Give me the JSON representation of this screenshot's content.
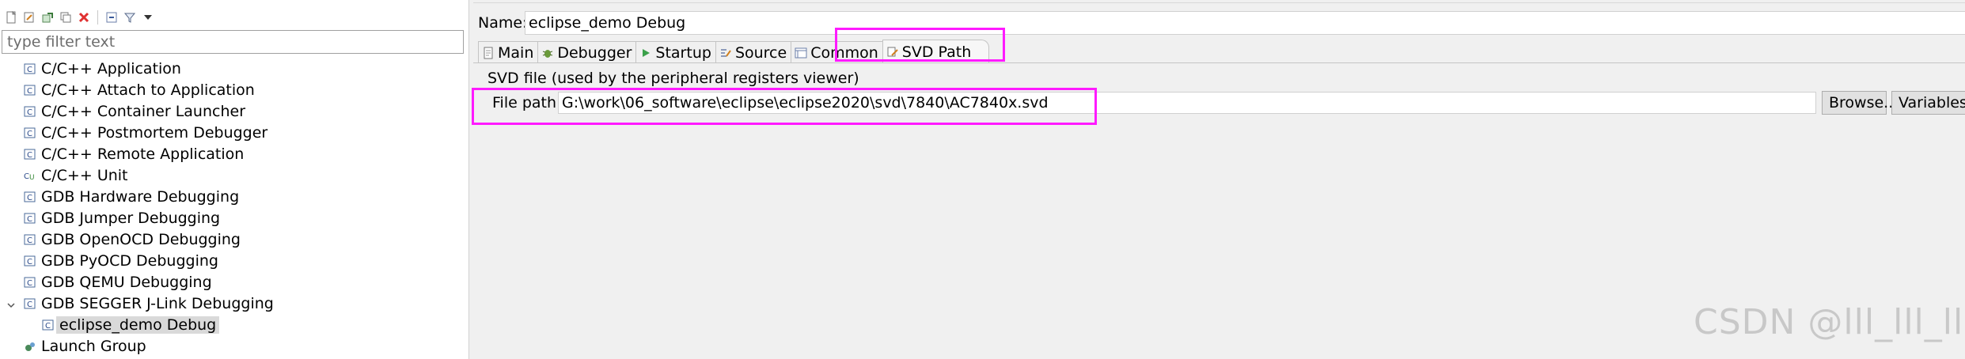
{
  "left_panel": {
    "filter_placeholder": "type filter text",
    "tree": [
      {
        "label": "C/C++ Application",
        "icon": "c-config-icon",
        "level": 1
      },
      {
        "label": "C/C++ Attach to Application",
        "icon": "c-config-icon",
        "level": 1
      },
      {
        "label": "C/C++ Container Launcher",
        "icon": "c-config-icon",
        "level": 1
      },
      {
        "label": "C/C++ Postmortem Debugger",
        "icon": "c-config-icon",
        "level": 1
      },
      {
        "label": "C/C++ Remote Application",
        "icon": "c-config-icon",
        "level": 1
      },
      {
        "label": "C/C++ Unit",
        "icon": "c-unit-icon",
        "level": 1
      },
      {
        "label": "GDB Hardware Debugging",
        "icon": "c-config-icon",
        "level": 1
      },
      {
        "label": "GDB Jumper Debugging",
        "icon": "c-config-icon",
        "level": 1
      },
      {
        "label": "GDB OpenOCD Debugging",
        "icon": "c-config-icon",
        "level": 1
      },
      {
        "label": "GDB PyOCD Debugging",
        "icon": "c-config-icon",
        "level": 1
      },
      {
        "label": "GDB QEMU Debugging",
        "icon": "c-config-icon",
        "level": 1
      },
      {
        "label": "GDB SEGGER J-Link Debugging",
        "icon": "c-config-icon",
        "level": 1,
        "expanded": true
      },
      {
        "label": "eclipse_demo Debug",
        "icon": "c-config-icon",
        "level": 2,
        "selected": true
      },
      {
        "label": "Launch Group",
        "icon": "launch-group-icon",
        "level": 1
      }
    ]
  },
  "right_panel": {
    "name_label": "Name:",
    "name_value": "eclipse_demo Debug",
    "tabs": [
      {
        "label": "Main",
        "icon": "main-tab-icon"
      },
      {
        "label": "Debugger",
        "icon": "debugger-tab-icon"
      },
      {
        "label": "Startup",
        "icon": "startup-tab-icon"
      },
      {
        "label": "Source",
        "icon": "source-tab-icon"
      },
      {
        "label": "Common",
        "icon": "common-tab-icon"
      },
      {
        "label": "SVD Path",
        "icon": "svd-tab-icon",
        "active": true
      }
    ],
    "svd_section_label": "SVD file (used by the peripheral registers viewer)",
    "file_path_label": "File path:",
    "file_path_value": "G:\\work\\06_software\\eclipse\\eclipse2020\\svd\\7840\\AC7840x.svd",
    "browse_label": "Browse...",
    "variables_label": "Variables..."
  },
  "watermark": "CSDN @lll_lll_lll",
  "colors": {
    "highlight": "#ff1aff",
    "selection": "#d9d9d9",
    "panel_bg": "#f0f0f0"
  }
}
